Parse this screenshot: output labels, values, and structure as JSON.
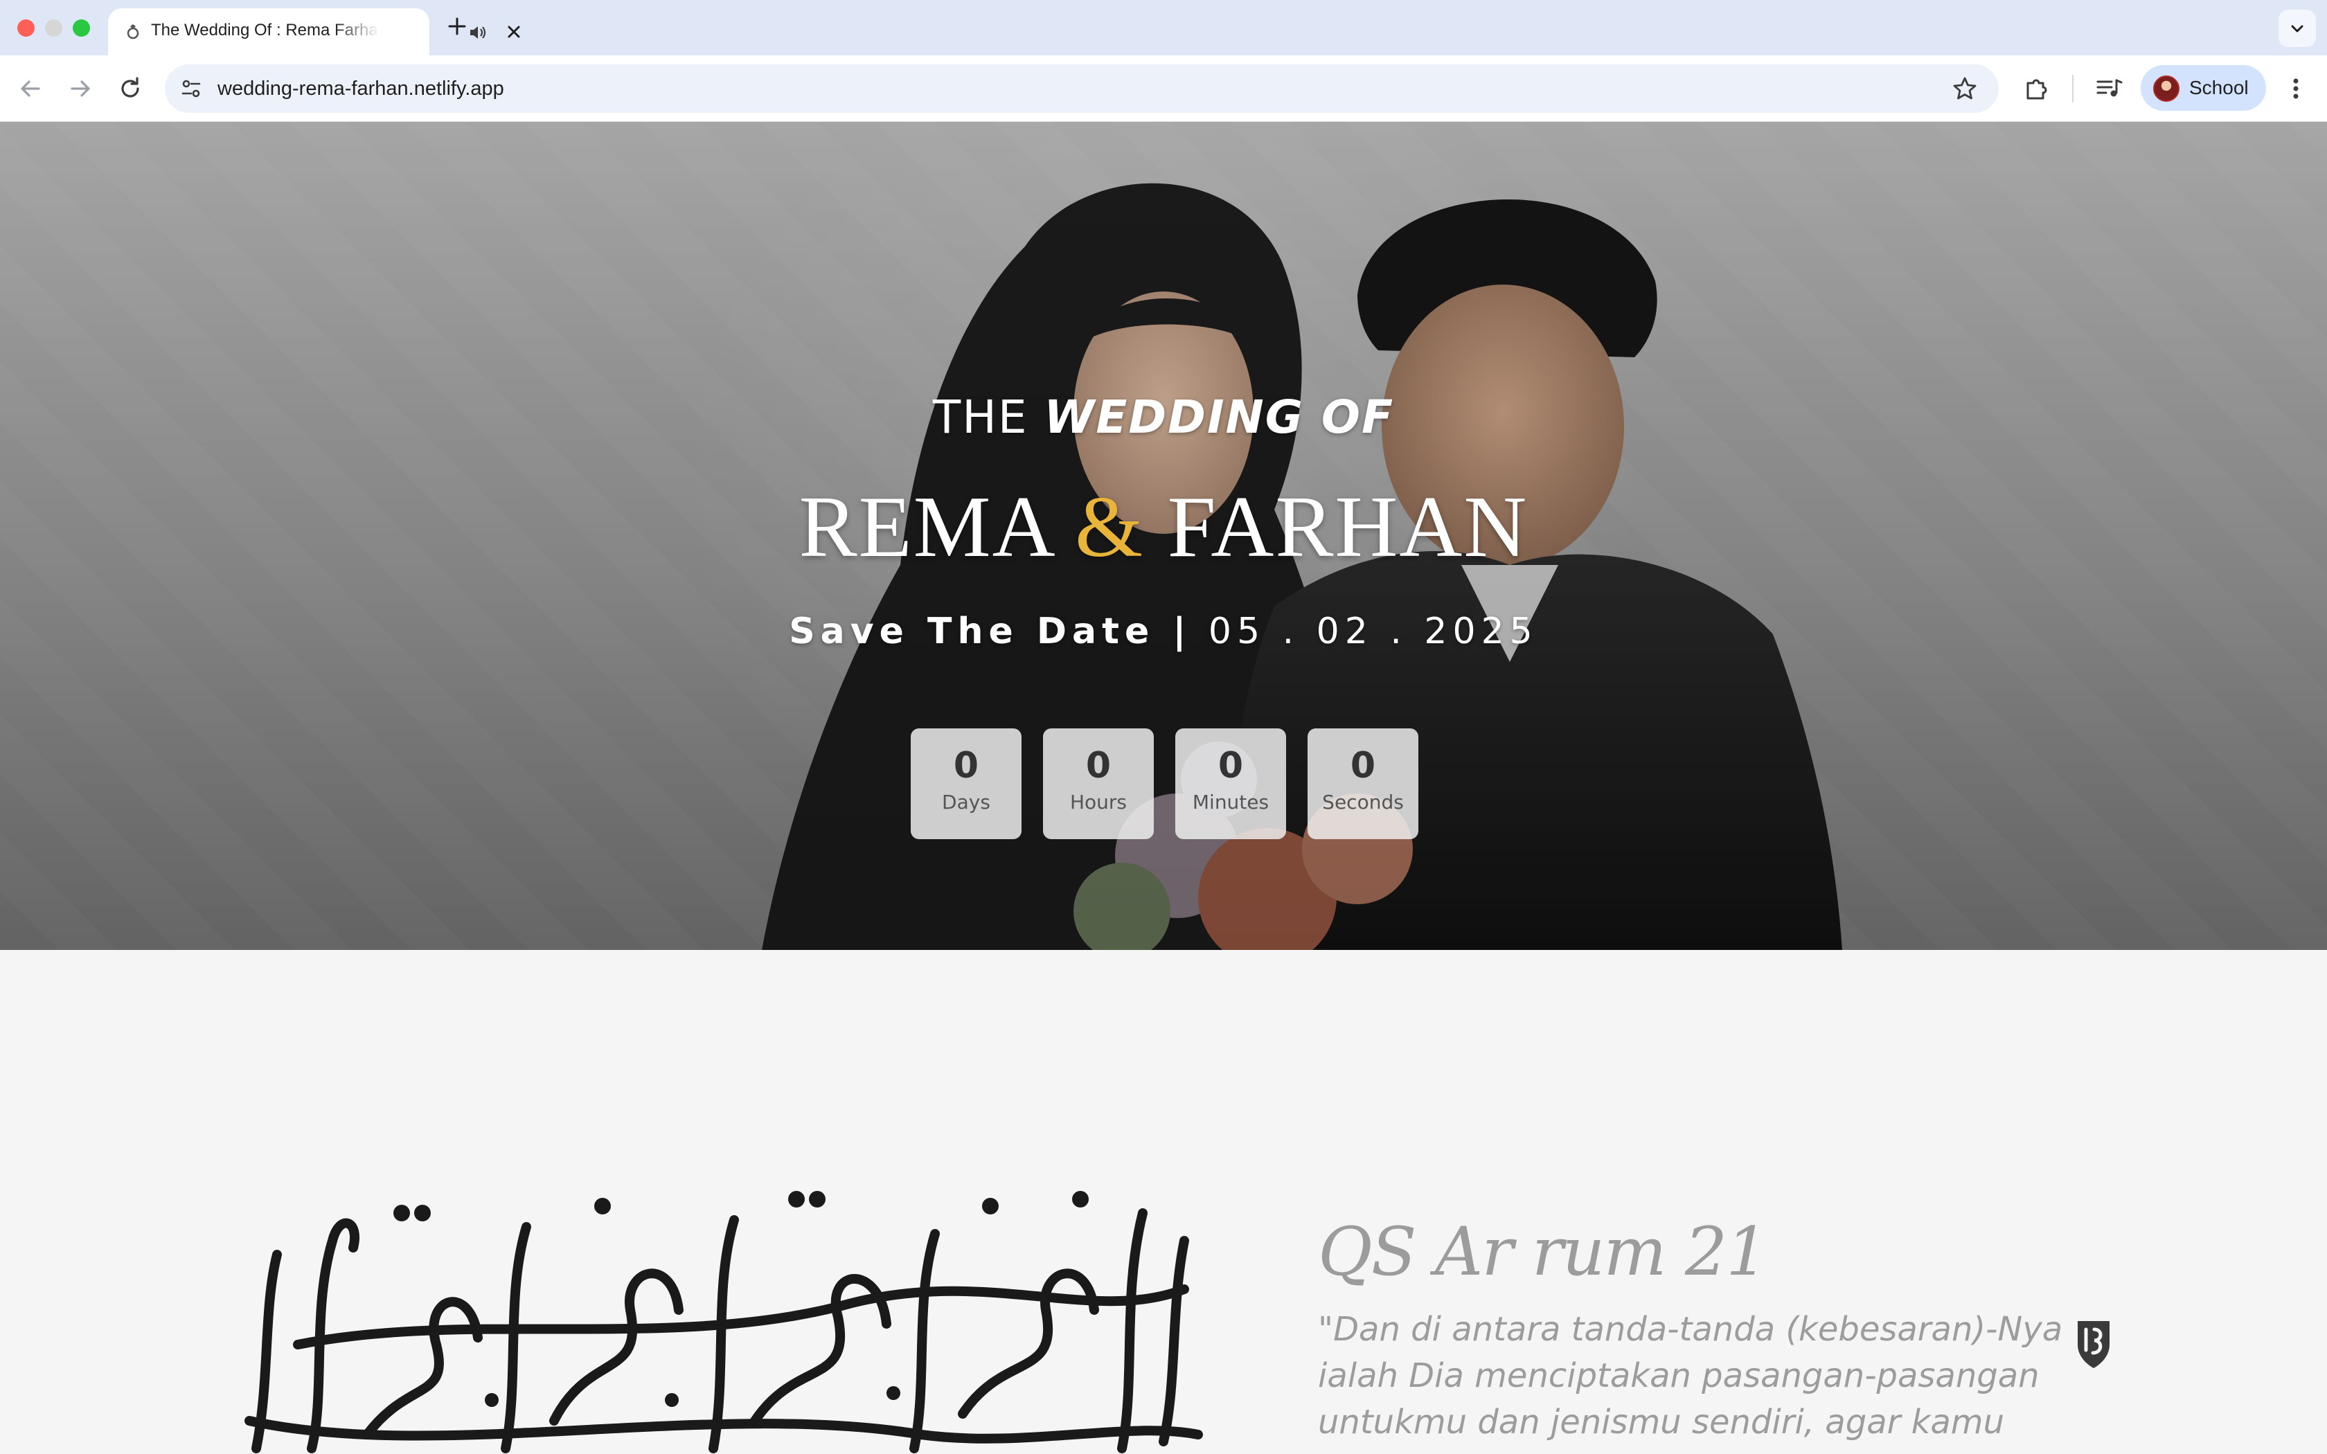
{
  "browser": {
    "tab_title": "The Wedding Of : Rema Farhan",
    "url": "wedding-rema-farhan.netlify.app",
    "profile_name": "School"
  },
  "hero": {
    "kicker_prefix": "THE",
    "kicker_emphasis": "WEDDING OF",
    "bride": "REMA",
    "ampersand": "&",
    "groom": "FARHAN",
    "date_label": "Save The Date |",
    "date_value": "05 . 02 . 2025",
    "countdown": [
      {
        "value": "0",
        "label": "Days"
      },
      {
        "value": "0",
        "label": "Hours"
      },
      {
        "value": "0",
        "label": "Minutes"
      },
      {
        "value": "0",
        "label": "Seconds"
      }
    ]
  },
  "verse": {
    "title": "QS Ar rum 21",
    "text": "\"Dan di antara tanda-tanda (kebesaran)-Nya ialah Dia menciptakan pasangan-pasangan untukmu dan jenismu sendiri, agar kamu"
  },
  "colors": {
    "accent_gold": "#e8b53a",
    "verse_gray": "#9c9c9c",
    "tab_strip": "#dfe7f7",
    "profile_chip": "#d3e3fd"
  },
  "icons": {
    "tab_favicon": "ring-icon",
    "tab_audio": "speaker-icon",
    "tab_close": "close-icon",
    "new_tab": "plus-icon",
    "back": "arrow-left-icon",
    "forward": "arrow-right-icon",
    "reload": "reload-icon",
    "site_info": "tune-icon",
    "bookmark": "star-icon",
    "extensions": "puzzle-icon",
    "media": "media-queue-icon",
    "menu": "more-vert-icon"
  }
}
